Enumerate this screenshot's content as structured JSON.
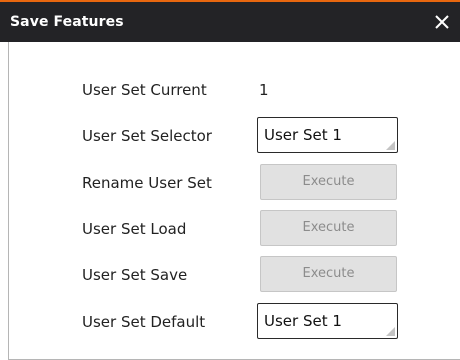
{
  "dialog": {
    "title": "Save Features",
    "close_glyph": "✕",
    "accent_color": "#e8670f",
    "titlebar_color": "#232326"
  },
  "rows": [
    {
      "label": "User Set Current",
      "value": "1"
    },
    {
      "label": "User Set Selector",
      "selected": "User Set 1"
    },
    {
      "label": "Rename User Set",
      "button": "Execute"
    },
    {
      "label": "User Set Load",
      "button": "Execute"
    },
    {
      "label": "User Set Save",
      "button": "Execute"
    },
    {
      "label": "User Set Default",
      "selected": "User Set 1"
    }
  ],
  "icons": {
    "close": "close-icon",
    "combo_grip": "resize-grip-icon"
  }
}
